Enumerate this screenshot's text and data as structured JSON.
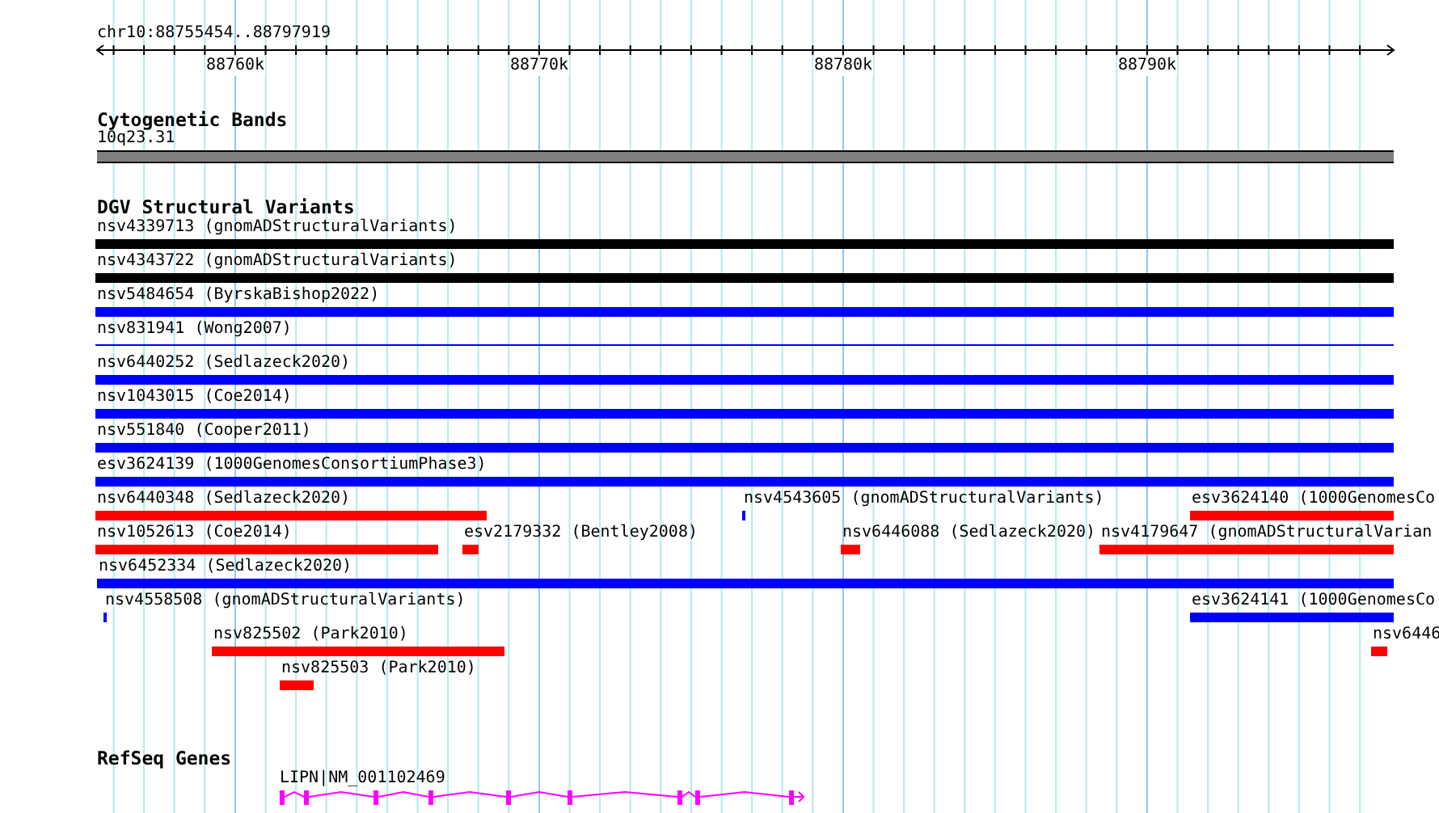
{
  "ruler": {
    "location": "chr10:88755454..88797919",
    "ticks": [
      "88760k",
      "88770k",
      "88780k",
      "88790k"
    ]
  },
  "tracks": [
    {
      "kind": "bands",
      "title": "Cytogenetic Bands",
      "features": [
        {
          "label": "10q23.31",
          "color": "#808080"
        }
      ]
    },
    {
      "kind": "variants",
      "title": "DGV Structural Variants",
      "features": [
        {
          "label": "nsv4339713 (gnomADStructuralVariants)",
          "color": "#000000"
        },
        {
          "label": "nsv4343722 (gnomADStructuralVariants)",
          "color": "#000000"
        },
        {
          "label": "nsv5484654 (ByrskaBishop2022)",
          "color": "#0000ff"
        },
        {
          "label": "nsv831941 (Wong2007)",
          "color": "#0000ff"
        },
        {
          "label": "nsv6440252 (Sedlazeck2020)",
          "color": "#0000ff"
        },
        {
          "label": "nsv1043015 (Coe2014)",
          "color": "#0000ff"
        },
        {
          "label": "nsv551840 (Cooper2011)",
          "color": "#0000ff"
        },
        {
          "label": "esv3624139 (1000GenomesConsortiumPhase3)",
          "color": "#0000ff"
        },
        {
          "label": "nsv6440348 (Sedlazeck2020)",
          "color": "#ff0000"
        },
        {
          "label": "nsv4543605 (gnomADStructuralVariants)",
          "color": "#0000ff"
        },
        {
          "label": "esv3624140 (1000GenomesCo",
          "color": "#ff0000"
        },
        {
          "label": "nsv1052613 (Coe2014)",
          "color": "#ff0000"
        },
        {
          "label": "esv2179332 (Bentley2008)",
          "color": "#ff0000"
        },
        {
          "label": "nsv6446088 (Sedlazeck2020)",
          "color": "#ff0000"
        },
        {
          "label": "nsv4179647 (gnomADStructuralVarian",
          "color": "#ff0000"
        },
        {
          "label": "nsv6452334 (Sedlazeck2020)",
          "color": "#0000ff"
        },
        {
          "label": "nsv4558508 (gnomADStructuralVariants)",
          "color": "#0000ff"
        },
        {
          "label": "esv3624141 (1000GenomesCo",
          "color": "#0000ff"
        },
        {
          "label": "nsv825502 (Park2010)",
          "color": "#ff0000"
        },
        {
          "label": "nsv6446",
          "color": "#ff0000"
        },
        {
          "label": "nsv825503 (Park2010)",
          "color": "#ff0000"
        }
      ]
    },
    {
      "kind": "genes",
      "title": "RefSeq Genes",
      "features": [
        {
          "label": "LIPN|NM_001102469",
          "color": "#ff00ff"
        }
      ]
    }
  ]
}
